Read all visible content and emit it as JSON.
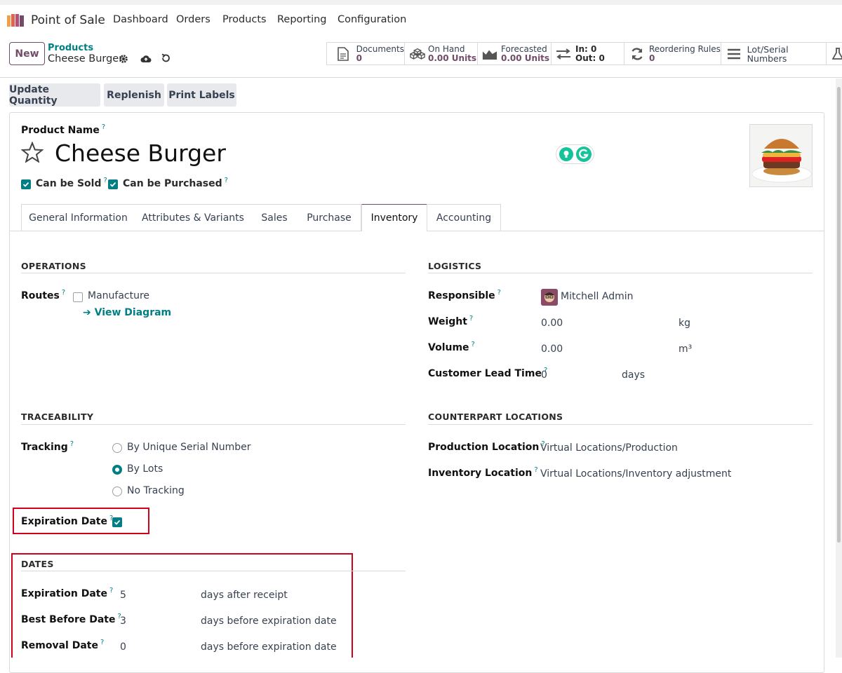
{
  "topbar": {
    "app_name": "Point of Sale",
    "menu": [
      "Dashboard",
      "Orders",
      "Products",
      "Reporting",
      "Configuration"
    ]
  },
  "control": {
    "new_label": "New",
    "breadcrumb_parent": "Products",
    "breadcrumb_current": "Cheese Burger",
    "stat_buttons": {
      "documents": {
        "label": "Documents",
        "value": "0"
      },
      "on_hand": {
        "label": "On Hand",
        "value": "0.00 Units"
      },
      "forecasted": {
        "label": "Forecasted",
        "value": "0.00 Units"
      },
      "in_out": {
        "in": "In: 0",
        "out": "Out: 0"
      },
      "reordering": {
        "label": "Reordering Rules",
        "value": "0"
      },
      "lots": {
        "label": "Lot/Serial Numbers"
      }
    }
  },
  "actions": {
    "update_qty": "Update Quantity",
    "replenish": "Replenish",
    "print_labels": "Print Labels"
  },
  "product": {
    "name_label": "Product Name",
    "help": "?",
    "name": "Cheese Burger",
    "can_be_sold": "Can be Sold",
    "can_be_purchased": "Can be Purchased"
  },
  "tabs": [
    "General Information",
    "Attributes & Variants",
    "Sales",
    "Purchase",
    "Inventory",
    "Accounting"
  ],
  "operations": {
    "title": "OPERATIONS",
    "routes_label": "Routes",
    "route_manufacture": "Manufacture",
    "view_diagram": "View Diagram"
  },
  "logistics": {
    "title": "LOGISTICS",
    "responsible_label": "Responsible",
    "responsible_value": "Mitchell Admin",
    "weight_label": "Weight",
    "weight_value": "0.00",
    "weight_unit": "kg",
    "volume_label": "Volume",
    "volume_value": "0.00",
    "volume_unit": "m³",
    "lead_label": "Customer Lead Time",
    "lead_value": "0",
    "lead_unit": "days"
  },
  "traceability": {
    "title": "TRACEABILITY",
    "tracking_label": "Tracking",
    "opt_serial": "By Unique Serial Number",
    "opt_lots": "By Lots",
    "opt_none": "No Tracking",
    "expiration_label": "Expiration Date"
  },
  "counterpart": {
    "title": "COUNTERPART LOCATIONS",
    "production_label": "Production Location",
    "production_value": "Virtual Locations/Production",
    "inventory_label": "Inventory Location",
    "inventory_value": "Virtual Locations/Inventory adjustment"
  },
  "dates": {
    "title": "DATES",
    "expiration_label": "Expiration Date",
    "expiration_value": "5",
    "expiration_unit": "days after receipt",
    "best_before_label": "Best Before Date",
    "best_before_value": "3",
    "best_before_unit": "days before expiration date",
    "removal_label": "Removal Date",
    "removal_value": "0",
    "removal_unit": "days before expiration date"
  },
  "colors": {
    "brand": "#714B67",
    "accent": "#017e84",
    "highlight": "#d0021b"
  }
}
